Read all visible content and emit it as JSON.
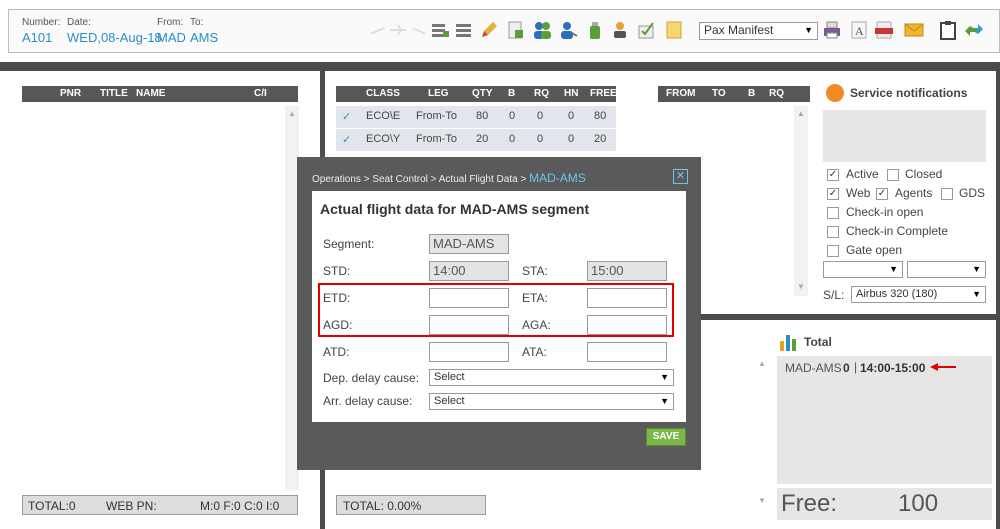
{
  "flight": {
    "number_label": "Number:",
    "number_value": "A101",
    "date_label": "Date:",
    "date_value": "WED,08-Aug-18",
    "from_label": "From:",
    "from_value": "MAD",
    "to_label": "To:",
    "to_value": "AMS"
  },
  "toolbar": {
    "report_select": "Pax Manifest",
    "icons": [
      "plane-takeoff-icon",
      "plane-icon",
      "plane-landing-icon",
      "add-list-icon",
      "list-icon",
      "edit-pencil-icon",
      "add-page-icon",
      "users-icon",
      "user-icon",
      "bottle-icon",
      "transfer-icon",
      "check-doc-icon",
      "notepad-icon"
    ],
    "right_icons": [
      "printer-icon",
      "font-icon",
      "pdf-icon",
      "email-icon",
      "clipboard-icon",
      "refresh-icon"
    ]
  },
  "pax_panel": {
    "columns": [
      "PNR",
      "TITLE",
      "NAME",
      "C/I"
    ],
    "footer": {
      "total": "TOTAL:0",
      "web": "WEB PN:",
      "classes": "M:0  F:0  C:0  I:0"
    }
  },
  "class_panel": {
    "columns": [
      "CLASS",
      "LEG",
      "QTY",
      "B",
      "RQ",
      "HN",
      "FREE"
    ],
    "rows": [
      {
        "class": "ECO\\E",
        "leg": "From-To",
        "qty": "80",
        "b": "0",
        "rq": "0",
        "hn": "0",
        "free": "80"
      },
      {
        "class": "ECO\\Y",
        "leg": "From-To",
        "qty": "20",
        "b": "0",
        "rq": "0",
        "hn": "0",
        "free": "20"
      }
    ],
    "footer_total": "TOTAL:  0.00%"
  },
  "route_panel": {
    "columns": [
      "FROM",
      "TO",
      "B",
      "RQ"
    ]
  },
  "notifications": {
    "title": "Service notifications",
    "checks": [
      {
        "label": "Active",
        "checked": true
      },
      {
        "label": "Closed",
        "checked": false
      },
      {
        "label": "Web",
        "checked": true
      },
      {
        "label": "Agents",
        "checked": true
      },
      {
        "label": "GDS",
        "checked": false
      },
      {
        "label": "Check-in open",
        "checked": false
      },
      {
        "label": "Check-in Complete",
        "checked": false
      },
      {
        "label": "Gate open",
        "checked": false
      }
    ],
    "sl_label": "S/L:",
    "sl_value": "Airbus 320 (180)"
  },
  "total_panel": {
    "title": "Total",
    "segment": "MAD-AMS",
    "count": "0",
    "times": "14:00-15:00",
    "free_label": "Free:",
    "free_value": "100"
  },
  "dialog": {
    "breadcrumb": "Operations > Seat Control > Actual Flight Data > ",
    "breadcrumb_current": "MAD-AMS",
    "heading": "Actual flight data for MAD-AMS segment",
    "segment_label": "Segment:",
    "segment_value": "MAD-AMS",
    "std_label": "STD:",
    "std_value": "14:00",
    "sta_label": "STA:",
    "sta_value": "15:00",
    "etd_label": "ETD:",
    "eta_label": "ETA:",
    "agd_label": "AGD:",
    "aga_label": "AGA:",
    "atd_label": "ATD:",
    "ata_label": "ATA:",
    "dep_delay_label": "Dep. delay cause:",
    "dep_delay_value": "Select",
    "arr_delay_label": "Arr. delay cause:",
    "arr_delay_value": "Select",
    "save_label": "SAVE"
  },
  "colors": {
    "accent": "#2a8fc7",
    "save_green": "#7ab648",
    "highlight_red": "#e00000",
    "dark": "#4b4b4b"
  }
}
